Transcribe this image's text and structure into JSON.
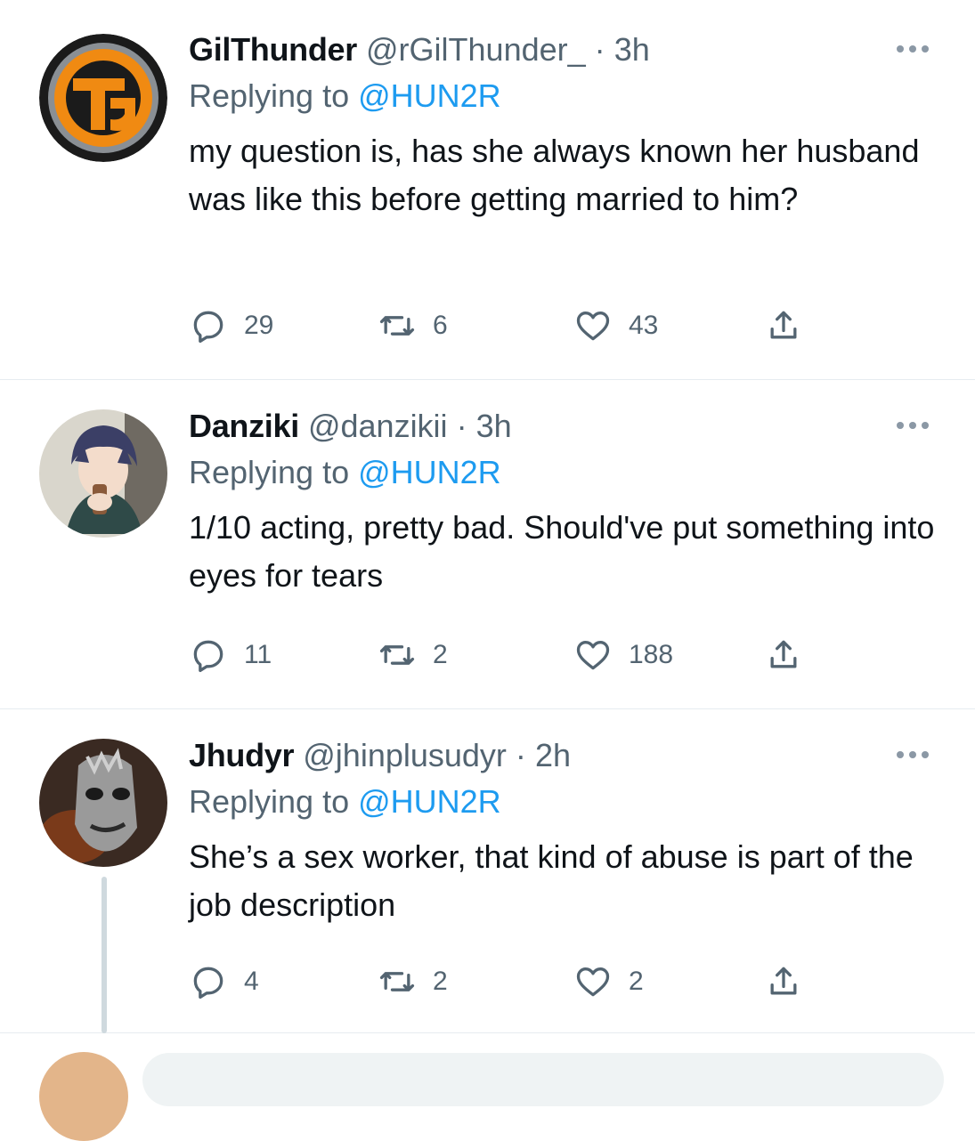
{
  "tweets": [
    {
      "display_name": "GilThunder",
      "handle": "@rGilThunder_",
      "dot": "·",
      "time": "3h",
      "replying_prefix": "Replying to",
      "replying_to": "@HUN2R",
      "text": "my question is, has she always known her husband was like this before getting married to him?",
      "replies": "29",
      "retweets": "6",
      "likes": "43",
      "avatar_icon": "gilthunder-logo-avatar"
    },
    {
      "display_name": "Danziki",
      "handle": "@danzikii",
      "dot": "·",
      "time": "3h",
      "replying_prefix": "Replying to",
      "replying_to": "@HUN2R",
      "text": "1/10 acting, pretty bad. Should've put something into eyes for tears",
      "replies": "11",
      "retweets": "2",
      "likes": "188",
      "avatar_icon": "anime-character-avatar"
    },
    {
      "display_name": "Jhudyr",
      "handle": "@jhinplusudyr",
      "dot": "·",
      "time": "2h",
      "replying_prefix": "Replying to",
      "replying_to": "@HUN2R",
      "text": "She’s a sex worker, that kind of abuse is part of the job description",
      "replies": "4",
      "retweets": "2",
      "likes": "2",
      "avatar_icon": "masked-figure-avatar"
    }
  ],
  "colors": {
    "link": "#1d9bf0",
    "secondary_text": "#536471",
    "divider": "#e6ecf0",
    "thread_line": "#cfd9de"
  },
  "icons": [
    "reply-icon",
    "retweet-icon",
    "like-icon",
    "share-icon",
    "more-options-icon"
  ]
}
